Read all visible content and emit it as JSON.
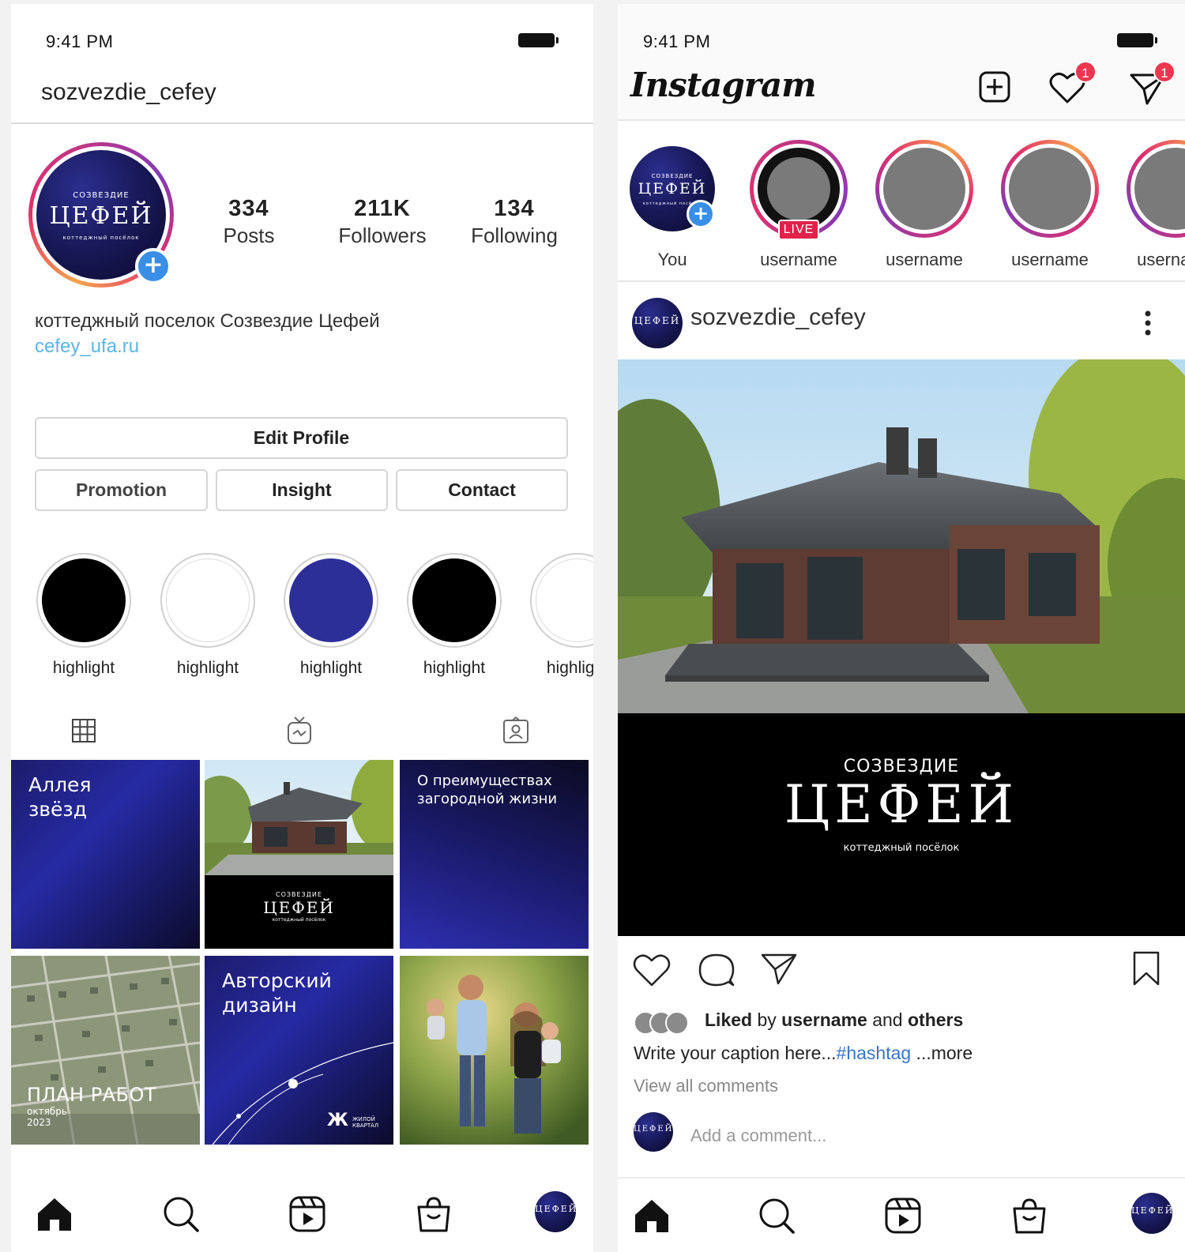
{
  "profile_screen": {
    "status_time": "9:41 PM",
    "username": "sozvezdie_cefey",
    "brand": {
      "top": "СОЗВЕЗДИЕ",
      "main": "ЦЕФЕЙ",
      "sub": "коттеджный посёлок"
    },
    "stats": [
      {
        "value": "334",
        "label": "Posts"
      },
      {
        "value": "211K",
        "label": "Followers"
      },
      {
        "value": "134",
        "label": "Following"
      }
    ],
    "bio": "коттеджный поселок Созвездие Цефей",
    "link": "cefey_ufa.ru",
    "buttons": {
      "edit": "Edit Profile",
      "promotion": "Promotion",
      "insight": "Insight",
      "contact": "Contact"
    },
    "highlights": [
      {
        "label": "highlight",
        "color": "#000000"
      },
      {
        "label": "highlight",
        "color": "#ffffff"
      },
      {
        "label": "highlight",
        "color": "#2d2f99"
      },
      {
        "label": "highlight",
        "color": "#000000"
      },
      {
        "label": "highlight",
        "color": "#ffffff"
      }
    ],
    "grid": {
      "tile1": "Аллея звёзд",
      "tile3": "О преимуществах загородной жизни",
      "tile4_title": "ПЛАН РАБОТ",
      "tile4_sub1": "октябрь",
      "tile4_sub2": "2023",
      "tile5": "Авторский дизайн",
      "tile5_logo_big": "Ж",
      "tile5_logo_small": "ЖИЛОЙ КВАРТАЛ"
    }
  },
  "feed_screen": {
    "status_time": "9:41 PM",
    "logo": "Instagram",
    "notifications": {
      "likes": "1",
      "messages": "1"
    },
    "stories": [
      {
        "label": "You"
      },
      {
        "label": "username",
        "live": "LIVE"
      },
      {
        "label": "username"
      },
      {
        "label": "username"
      },
      {
        "label": "username"
      }
    ],
    "post": {
      "username": "sozvezdie_cefey",
      "brand_top": "СОЗВЕЗДИЕ",
      "brand_main": "ЦЕФЕЙ",
      "brand_sub": "коттеджный посёлок",
      "liked_prefix": "Liked",
      "liked_by": "by",
      "liked_user": "username",
      "liked_and": "and",
      "liked_others": "others",
      "caption": "Write your caption here...",
      "hashtag": "#hashtag",
      "more": " ...more",
      "view_all": "View all comments",
      "add_comment_placeholder": "Add a comment..."
    }
  },
  "colors": {
    "accent_blue": "#3a8ee6",
    "link": "#5bb4e6",
    "notification": "#f0364f",
    "live": "#e0224a",
    "brand_navy": "#1a1a5c"
  }
}
